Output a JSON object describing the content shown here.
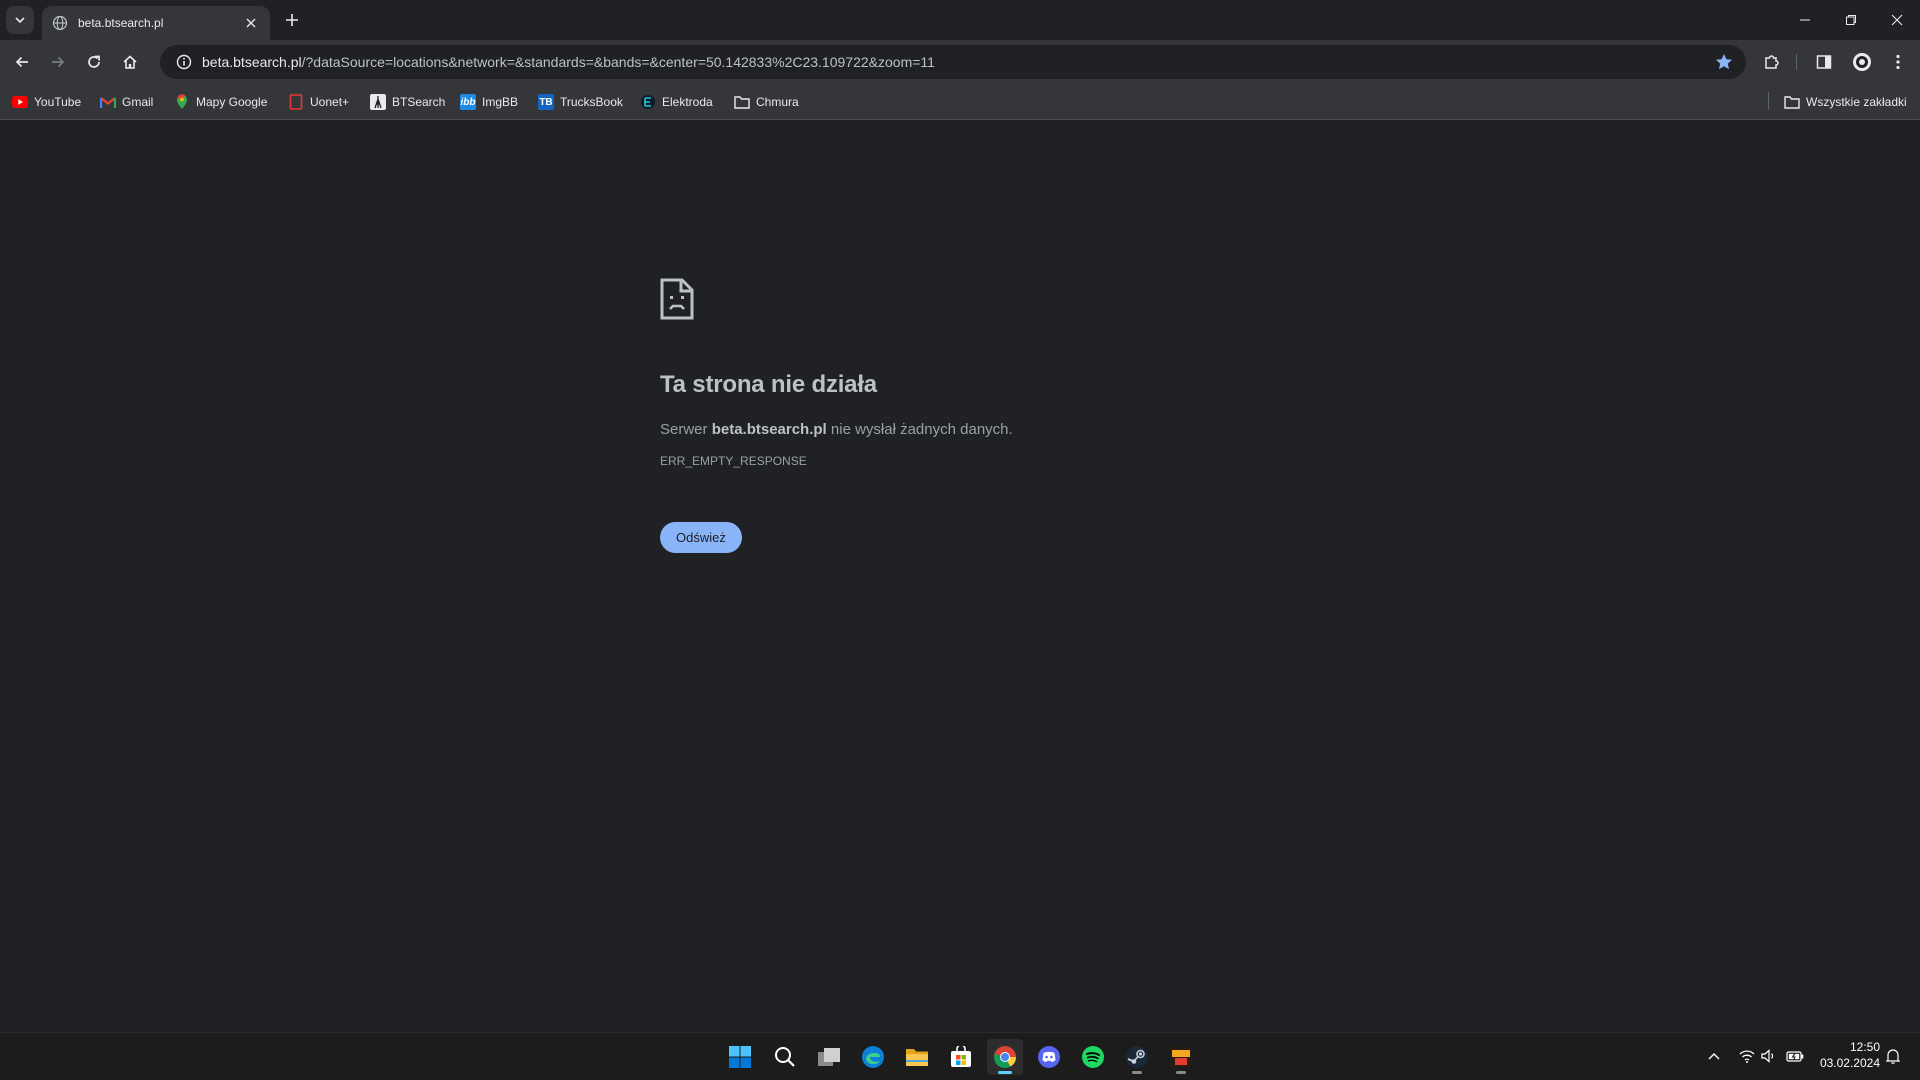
{
  "browser": {
    "tab": {
      "title": "beta.btsearch.pl"
    },
    "url": {
      "host": "beta.btsearch.pl",
      "rest": "/?dataSource=locations&network=&standards=&bands=&center=50.142833%2C23.109722&zoom=11"
    }
  },
  "bookmarks": {
    "items": [
      {
        "label": "YouTube",
        "icon": "youtube-icon"
      },
      {
        "label": "Gmail",
        "icon": "gmail-icon"
      },
      {
        "label": "Mapy Google",
        "icon": "maps-pin-icon"
      },
      {
        "label": "Uonet+",
        "icon": "uonet-icon"
      },
      {
        "label": "BTSearch",
        "icon": "btsearch-icon"
      },
      {
        "label": "ImgBB",
        "icon": "imgbb-icon"
      },
      {
        "label": "TrucksBook",
        "icon": "trucksbook-icon"
      },
      {
        "label": "Elektroda",
        "icon": "elektroda-icon"
      },
      {
        "label": "Chmura",
        "icon": "folder-icon"
      }
    ],
    "all": "Wszystkie zakładki"
  },
  "error": {
    "title": "Ta strona nie działa",
    "desc_prefix": "Serwer ",
    "desc_host": "beta.btsearch.pl",
    "desc_suffix": " nie wysłał żadnych danych.",
    "code": "ERR_EMPTY_RESPONSE",
    "button": "Odśwież"
  },
  "taskbar": {
    "apps": [
      "windows-start-icon",
      "search-icon",
      "task-view-icon",
      "edge-icon",
      "file-explorer-icon",
      "store-icon",
      "chrome-icon",
      "discord-icon",
      "spotify-icon",
      "steam-icon",
      "cms-icon"
    ],
    "time": "12:50",
    "date": "03.02.2024"
  },
  "colors": {
    "accent": "#8ab4f8",
    "background": "#202124",
    "toolbar": "#35363a"
  }
}
